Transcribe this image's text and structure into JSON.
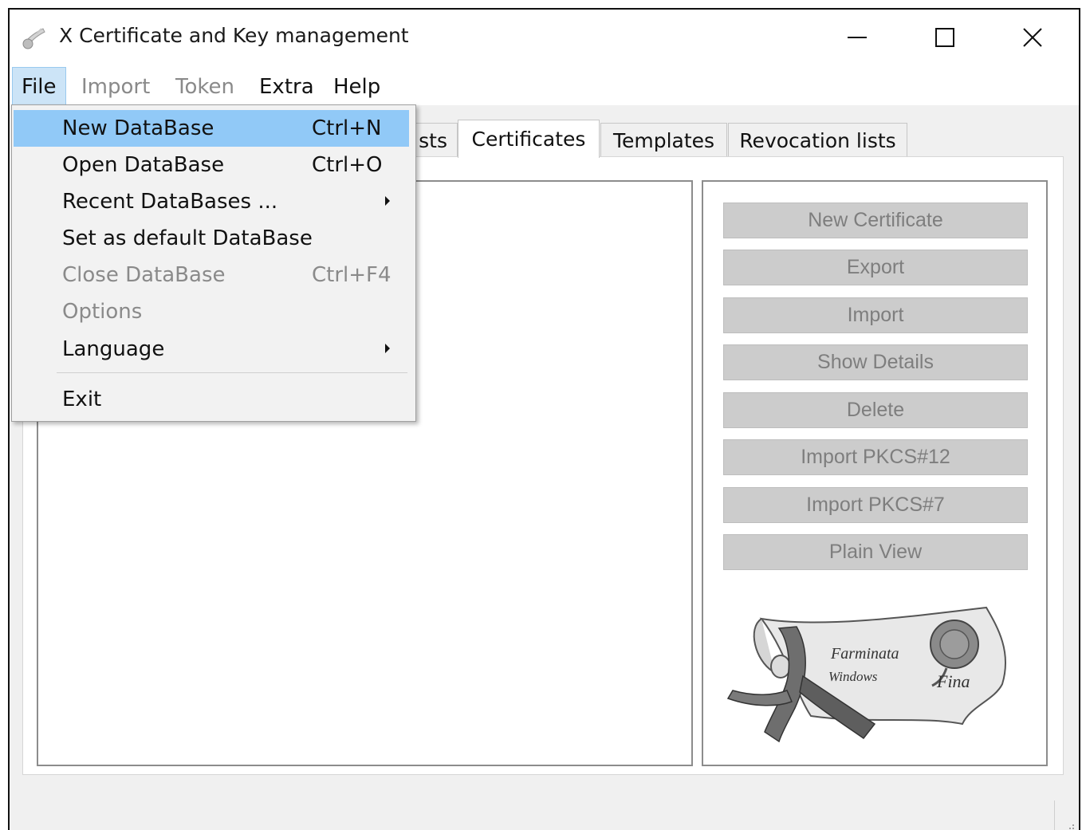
{
  "window": {
    "title": "X Certificate and Key management",
    "icon": "certificate-ribbon-icon",
    "controls": {
      "minimize": "minimize-icon",
      "maximize": "maximize-icon",
      "close": "close-icon"
    }
  },
  "menubar": {
    "file": "File",
    "import": "Import",
    "token": "Token",
    "extra": "Extra",
    "help": "Help"
  },
  "file_menu": {
    "items": [
      {
        "label": "New DataBase",
        "shortcut": "Ctrl+N",
        "state": "highlighted"
      },
      {
        "label": "Open DataBase",
        "shortcut": "Ctrl+O",
        "state": "enabled"
      },
      {
        "label": "Recent DataBases ...",
        "shortcut": "",
        "state": "enabled",
        "submenu": true
      },
      {
        "label": "Set as default DataBase",
        "shortcut": "",
        "state": "enabled"
      },
      {
        "label": "Close DataBase",
        "shortcut": "Ctrl+F4",
        "state": "disabled"
      },
      {
        "label": "Options",
        "shortcut": "",
        "state": "disabled"
      },
      {
        "label": "Language",
        "shortcut": "",
        "state": "enabled",
        "submenu": true
      },
      {
        "label": "Exit",
        "shortcut": "",
        "state": "enabled"
      }
    ]
  },
  "tabs": {
    "requests_partial": "sts",
    "certificates": "Certificates",
    "templates": "Templates",
    "revocation_lists": "Revocation lists",
    "selected": "Certificates"
  },
  "buttons": {
    "new_certificate": "New Certificate",
    "export": "Export",
    "import": "Import",
    "show_details": "Show Details",
    "delete": "Delete",
    "import_pkcs12": "Import PKCS#12",
    "import_pkcs7": "Import PKCS#7",
    "plain_view": "Plain View",
    "state": "disabled"
  },
  "illustration": {
    "icon": "scroll-with-seal-image",
    "text_line1": "Farminata",
    "text_line2": "Windows",
    "text_line3": "Fina"
  },
  "colors": {
    "menu_highlight": "#91c9f7",
    "menubar_active": "#cce4f7",
    "disabled_text": "#8a8a8a",
    "button_bg": "#cccccc"
  }
}
